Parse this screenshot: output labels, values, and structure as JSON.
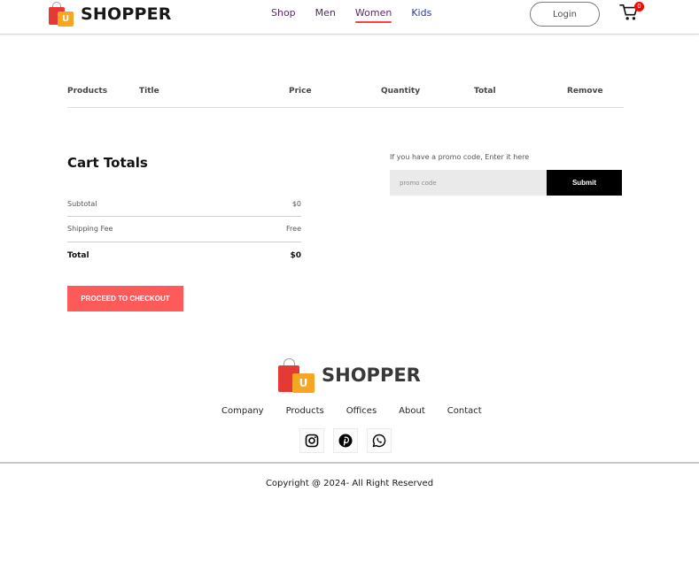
{
  "brand": {
    "name": "SHOPPER",
    "logo_letter": "U"
  },
  "nav": {
    "items": [
      {
        "label": "Shop"
      },
      {
        "label": "Men"
      },
      {
        "label": "Women"
      },
      {
        "label": "Kids"
      }
    ],
    "active": "Women",
    "login_label": "Login",
    "cart_count": "0"
  },
  "cart": {
    "columns": [
      "Products",
      "Title",
      "Price",
      "Quantity",
      "Total",
      "Remove"
    ]
  },
  "totals": {
    "title": "Cart Totals",
    "subtotal_label": "Subtotal",
    "subtotal_value": "$0",
    "shipping_label": "Shipping Fee",
    "shipping_value": "Free",
    "total_label": "Total",
    "total_value": "$0",
    "checkout_label": "PROCEED TO CHECKOUT"
  },
  "promo": {
    "label": "If you have a promo code, Enter it here",
    "placeholder": "promo code",
    "submit_label": "Submit"
  },
  "footer": {
    "links": [
      "Company",
      "Products",
      "Offices",
      "About",
      "Contact"
    ],
    "social": [
      "instagram-icon",
      "pinterest-icon",
      "whatsapp-icon"
    ],
    "copyright": "Copyright @ 2024- All Right Reserved"
  },
  "colors": {
    "accent": "#ff4141",
    "checkout": "#ff5a5a",
    "submit": "#000000"
  }
}
